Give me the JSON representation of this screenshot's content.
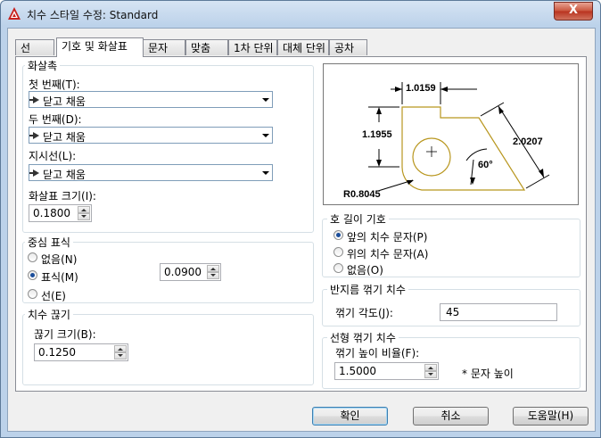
{
  "window": {
    "title": "치수 스타일 수정: Standard",
    "close_label": "X"
  },
  "tabs": [
    {
      "label": "선",
      "active": false
    },
    {
      "label": "기호 및 화살표",
      "active": true
    },
    {
      "label": "문자",
      "active": false
    },
    {
      "label": "맞춤",
      "active": false
    },
    {
      "label": "1차 단위",
      "active": false
    },
    {
      "label": "대체 단위",
      "active": false
    },
    {
      "label": "공차",
      "active": false
    }
  ],
  "arrowheads": {
    "legend": "화살촉",
    "first_label": "첫 번째(T):",
    "first_value": "닫고 채움",
    "second_label": "두 번째(D):",
    "second_value": "닫고 채움",
    "leader_label": "지시선(L):",
    "leader_value": "닫고 채움",
    "size_label": "화살표 크기(I):",
    "size_value": "0.1800"
  },
  "center_marks": {
    "legend": "중심 표식",
    "none_label": "없음(N)",
    "mark_label": "표식(M)",
    "line_label": "선(E)",
    "selected": "mark",
    "size_value": "0.0900"
  },
  "dimension_break": {
    "legend": "치수 끊기",
    "size_label": "끊기 크기(B):",
    "size_value": "0.1250"
  },
  "arc_length": {
    "legend": "호 길이 기호",
    "preceding_label": "앞의 치수 문자(P)",
    "above_label": "위의 치수 문자(A)",
    "none_label": "없음(O)",
    "selected": "preceding"
  },
  "radius_jog": {
    "legend": "반지름 꺾기 치수",
    "angle_label": "꺾기 각도(J):",
    "angle_value": "45"
  },
  "linear_jog": {
    "legend": "선형 꺾기 치수",
    "height_label": "꺾기 높이 비율(F):",
    "height_value": "1.5000",
    "unit_note": "* 문자 높이"
  },
  "preview": {
    "dim_top": "1.0159",
    "dim_left": "1.1955",
    "dim_right": "2.0207",
    "dim_angle": "60°",
    "dim_radius": "R0.8045"
  },
  "buttons": {
    "ok": "확인",
    "cancel": "취소",
    "help": "도움말(H)"
  },
  "colors": {
    "title_bar": "#bcd2ea",
    "close_button": "#c9543c",
    "preview_outline": "#b8961e",
    "radio_selected": "#1b4e9b"
  }
}
